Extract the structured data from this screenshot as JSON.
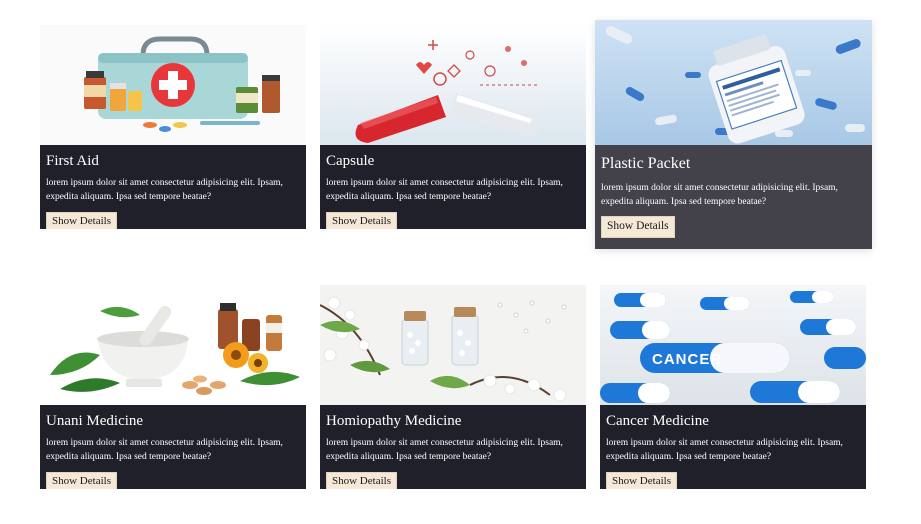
{
  "cards": [
    {
      "title": "First Aid",
      "description": "lorem ipsum dolor sit amet consectetur adipisicing elit. Ipsam, expedita aliquam. Ipsa sed tempore beatae?",
      "button_label": "Show Details",
      "image": "first-aid-kit-image"
    },
    {
      "title": "Capsule",
      "description": "lorem ipsum dolor sit amet consectetur adipisicing elit. Ipsam, expedita aliquam. Ipsa sed tempore beatae?",
      "button_label": "Show Details",
      "image": "capsule-image"
    },
    {
      "title": "Plastic Packet",
      "description": "lorem ipsum dolor sit amet consectetur adipisicing elit. Ipsam, expedita aliquam. Ipsa sed tempore beatae?",
      "button_label": "Show Details",
      "image": "pill-bottle-image"
    },
    {
      "title": "Unani Medicine",
      "description": "lorem ipsum dolor sit amet consectetur adipisicing elit. Ipsam, expedita aliquam. Ipsa sed tempore beatae?",
      "button_label": "Show Details",
      "image": "mortar-pestle-herbs-image"
    },
    {
      "title": "Homiopathy Medicine",
      "description": "lorem ipsum dolor sit amet consectetur adipisicing elit. Ipsam, expedita aliquam. Ipsa sed tempore beatae?",
      "button_label": "Show Details",
      "image": "homeopathy-vials-flowers-image"
    },
    {
      "title": "Cancer Medicine",
      "description": "lorem ipsum dolor sit amet consectetur adipisicing elit. Ipsam, expedita aliquam. Ipsa sed tempore beatae?",
      "button_label": "Show Details",
      "image": "cancer-capsules-image",
      "image_text": "CANCER"
    }
  ],
  "colors": {
    "card_body": "#20202b",
    "card_body_featured": "#43414a",
    "button_bg": "#f6e8d6",
    "text": "#ffffff"
  }
}
